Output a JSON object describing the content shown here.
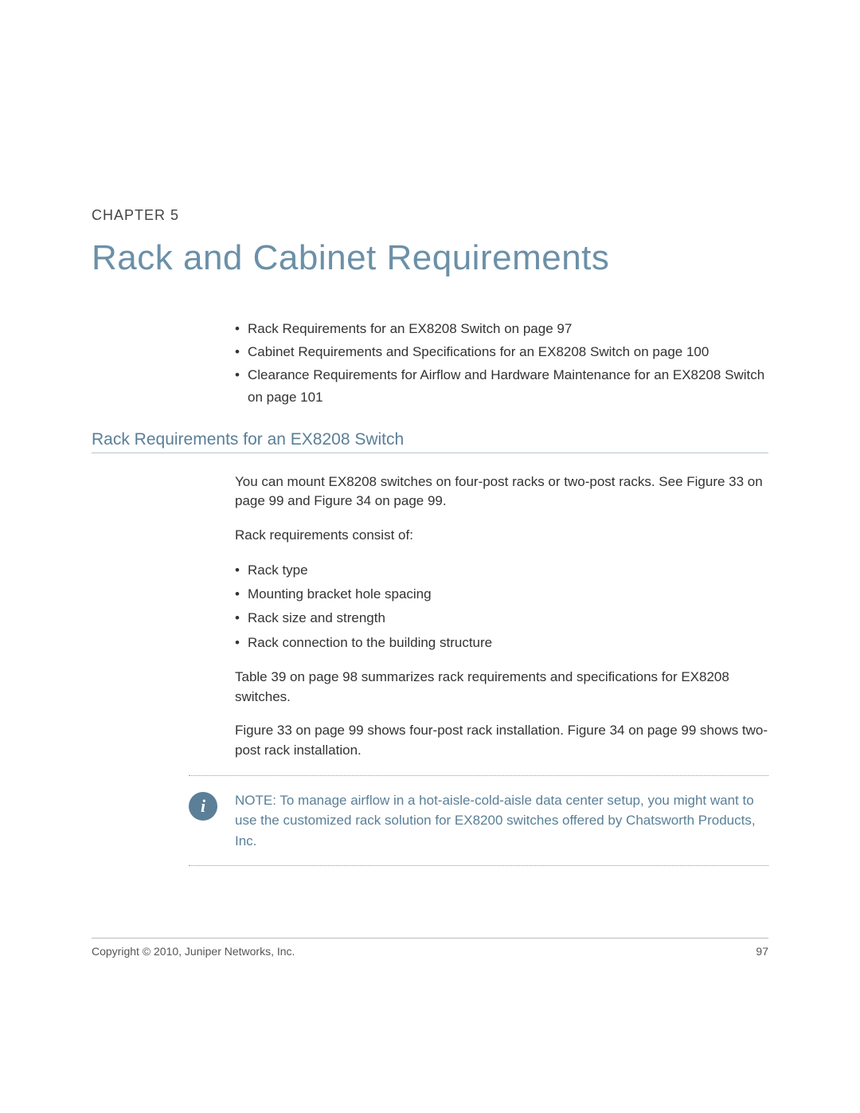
{
  "chapter": {
    "label": "CHAPTER 5",
    "title": "Rack and Cabinet Requirements"
  },
  "toc": [
    "Rack Requirements for an EX8208 Switch on page 97",
    "Cabinet Requirements and Specifications for an EX8208 Switch on page 100",
    "Clearance Requirements for Airflow and Hardware Maintenance for an EX8208 Switch on page 101"
  ],
  "section": {
    "heading": "Rack Requirements for an EX8208 Switch",
    "intro": "You can mount EX8208 switches on four-post racks or two-post racks. See Figure 33 on page 99 and Figure 34 on page 99.",
    "req_intro": "Rack requirements consist of:",
    "req_list": [
      "Rack type",
      "Mounting bracket hole spacing",
      "Rack size and strength",
      "Rack connection to the building structure"
    ],
    "summary1": "Table 39 on page 98 summarizes rack requirements and specifications for EX8208 switches.",
    "summary2": "Figure 33 on page 99 shows four-post rack installation. Figure 34 on page 99 shows two-post rack installation."
  },
  "note": {
    "icon_glyph": "i",
    "text": "NOTE:  To manage airflow in a hot-aisle-cold-aisle data center setup, you might want to use the customized rack solution for EX8200 switches offered by Chatsworth Products, Inc."
  },
  "footer": {
    "copyright": "Copyright © 2010, Juniper Networks, Inc.",
    "page": "97"
  }
}
